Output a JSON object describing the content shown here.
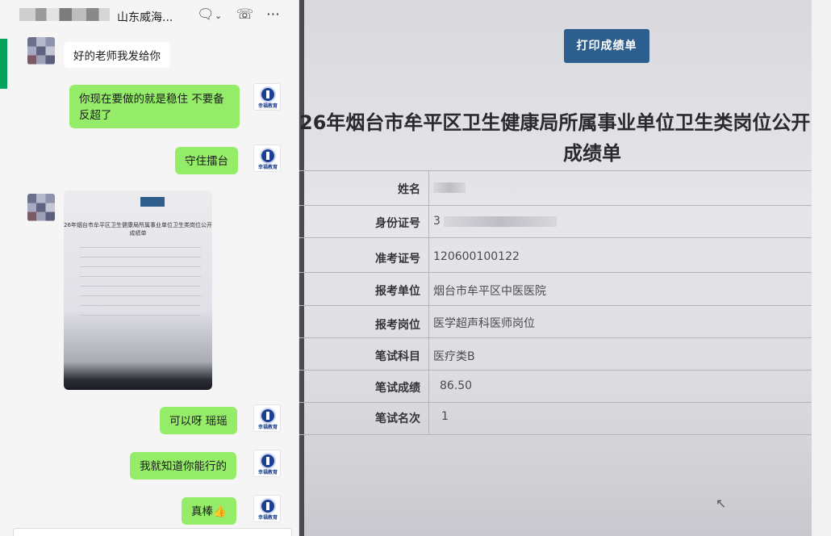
{
  "chat": {
    "contact_name": "山东威海...",
    "messages": [
      {
        "side": "in",
        "text": "好的老师我发给你"
      },
      {
        "side": "out",
        "text": "你现在要做的就是稳住 不要备反超了"
      },
      {
        "side": "out",
        "text": "守住擂台"
      },
      {
        "side": "in",
        "type": "image"
      },
      {
        "side": "out",
        "text": "可以呀 瑶瑶"
      },
      {
        "side": "out",
        "text": "我就知道你能行的"
      },
      {
        "side": "out",
        "text": "真棒👍"
      }
    ],
    "self_avatar_text": "幸福教育",
    "header_icons": [
      "chat-bubble-icon",
      "chevron-down-icon",
      "phone-icon",
      "more-icon"
    ]
  },
  "photo": {
    "print_button": "打印成绩单",
    "title": "26年烟台市牟平区卫生健康局所属事业单位卫生类岗位公开",
    "subtitle": "成绩单",
    "rows": [
      {
        "label": "姓名",
        "value": ""
      },
      {
        "label": "身份证号",
        "value": "3"
      },
      {
        "label": "准考证号",
        "value": "120600100122"
      },
      {
        "label": "报考单位",
        "value": "烟台市牟平区中医医院"
      },
      {
        "label": "报考岗位",
        "value": "医学超声科医师岗位"
      },
      {
        "label": "笔试科目",
        "value": "医疗类B"
      },
      {
        "label": "笔试成绩",
        "value": "86.50"
      },
      {
        "label": "笔试名次",
        "value": "1"
      }
    ]
  }
}
